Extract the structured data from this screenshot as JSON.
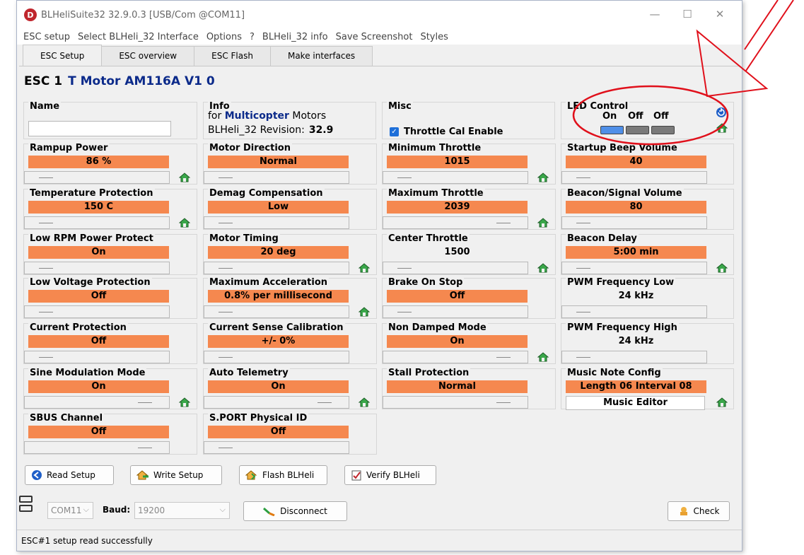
{
  "window": {
    "title": "BLHeliSuite32 32.9.0.3  [USB/Com @COM11]",
    "app_icon_letter": "D"
  },
  "menu": [
    "ESC setup",
    "Select BLHeli_32 Interface",
    "Options",
    "?",
    "BLHeli_32 info",
    "Save Screenshot",
    "Styles"
  ],
  "tabs": [
    "ESC Setup",
    "ESC overview",
    "ESC Flash",
    "Make interfaces"
  ],
  "esc": {
    "label": "ESC 1",
    "model": "T Motor AM116A V1 0"
  },
  "name_group": {
    "label": "Name",
    "value": ""
  },
  "info": {
    "label": "Info",
    "for_prefix": "for",
    "motor_type": "Multicopter",
    "for_suffix": "Motors",
    "revision_label": "BLHeli_32 Revision:",
    "revision_value": "32.9"
  },
  "misc": {
    "label": "Misc",
    "throttle_cal_label": "Throttle Cal Enable",
    "throttle_cal_checked": true
  },
  "led": {
    "label": "LED Control",
    "states": [
      "On",
      "Off",
      "Off"
    ],
    "colors": [
      "#4f8fe8",
      "#7a7a7a",
      "#7a7a7a"
    ]
  },
  "params": [
    {
      "label": "Rampup Power",
      "value": "86 %",
      "highlight": true
    },
    {
      "label": "Motor Direction",
      "value": "Normal",
      "highlight": true
    },
    {
      "label": "Minimum Throttle",
      "value": "1015",
      "highlight": true
    },
    {
      "label": "Startup Beep Volume",
      "value": "40",
      "highlight": true
    },
    {
      "label": "Temperature Protection",
      "value": "150 C",
      "highlight": true
    },
    {
      "label": "Demag Compensation",
      "value": "Low",
      "highlight": true
    },
    {
      "label": "Maximum Throttle",
      "value": "2039",
      "highlight": true
    },
    {
      "label": "Beacon/Signal Volume",
      "value": "80",
      "highlight": true
    },
    {
      "label": "Low RPM Power Protect",
      "value": "On",
      "highlight": true
    },
    {
      "label": "Motor Timing",
      "value": "20 deg",
      "highlight": true
    },
    {
      "label": "Center Throttle",
      "value": "1500",
      "highlight": false
    },
    {
      "label": "Beacon Delay",
      "value": "5:00 min",
      "highlight": true
    },
    {
      "label": "Low Voltage Protection",
      "value": "Off",
      "highlight": true
    },
    {
      "label": "Maximum Acceleration",
      "value": "0.8% per millisecond",
      "highlight": true
    },
    {
      "label": "Brake On Stop",
      "value": "Off",
      "highlight": true
    },
    {
      "label": "PWM Frequency Low",
      "value": "24 kHz",
      "highlight": false
    },
    {
      "label": "Current Protection",
      "value": "Off",
      "highlight": true
    },
    {
      "label": "Current Sense Calibration",
      "value": "+/- 0%",
      "highlight": true
    },
    {
      "label": "Non Damped Mode",
      "value": "On",
      "highlight": true
    },
    {
      "label": "PWM Frequency High",
      "value": "24 kHz",
      "highlight": false
    },
    {
      "label": "Sine Modulation Mode",
      "value": "On",
      "highlight": true
    },
    {
      "label": "Auto Telemetry",
      "value": "On",
      "highlight": true
    },
    {
      "label": "Stall Protection",
      "value": "Normal",
      "highlight": true
    },
    {
      "label": "Music Note Config",
      "value": "Length 06 Interval 08",
      "highlight": true
    },
    {
      "label": "SBUS Channel",
      "value": "Off",
      "highlight": true
    },
    {
      "label": "S.PORT Physical ID",
      "value": "Off",
      "highlight": true
    }
  ],
  "music_editor_label": "Music Editor",
  "buttons": {
    "read": "Read Setup",
    "write": "Write Setup",
    "flash": "Flash BLHeli",
    "verify": "Verify BLHeli"
  },
  "connection": {
    "port": "COM11",
    "baud_label": "Baud:",
    "baud": "19200",
    "disconnect": "Disconnect",
    "check": "Check"
  },
  "status": "ESC#1 setup read successfully",
  "colors": {
    "accent_orange": "#f5884f",
    "model_blue": "#0b2a8a",
    "annotation_red": "#e0101b"
  }
}
